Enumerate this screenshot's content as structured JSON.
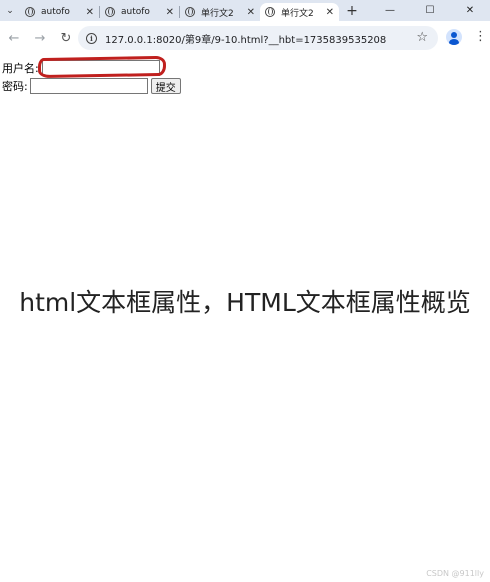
{
  "browser": {
    "tabs": [
      {
        "title": "autofo",
        "active": false
      },
      {
        "title": "autofo",
        "active": false
      },
      {
        "title": "单行文2",
        "active": false
      },
      {
        "title": "单行文2",
        "active": true
      }
    ],
    "new_tab_glyph": "+",
    "url": "127.0.0.1:8020/第9章/9-10.html?__hbt=1735839535208",
    "window_controls": {
      "minimize": "—",
      "maximize": "☐",
      "close": "✕"
    }
  },
  "form": {
    "username_label": "用户名:",
    "password_label": "密码:",
    "username_value": "",
    "password_value": "",
    "submit_label": "提交"
  },
  "annotation": {
    "color": "#c0201e"
  },
  "caption": "html文本框属性，HTML文本框属性概览",
  "watermark": "CSDN @911lly"
}
